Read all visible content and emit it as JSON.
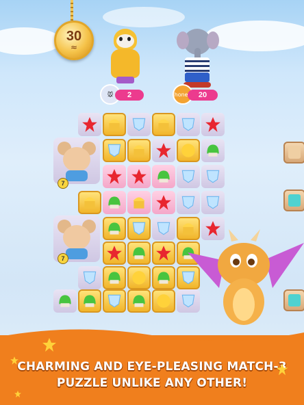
{
  "level_medal": {
    "moves": "30",
    "moves_icon": "scroll-icon"
  },
  "hud": {
    "player_count": "2",
    "opponent_icon_text": "honey",
    "opponent_count": "20"
  },
  "board": {
    "mouse_counter_1": "7",
    "mouse_counter_2": "7"
  },
  "banner": {
    "line1": "CHARMING AND EYE-PLEASING MATCH-3",
    "line2": "PUZZLE UNLIKE ANY OTHER!"
  },
  "colors": {
    "accent": "#f07f1d",
    "hud_pill": "#ec3b8e"
  }
}
